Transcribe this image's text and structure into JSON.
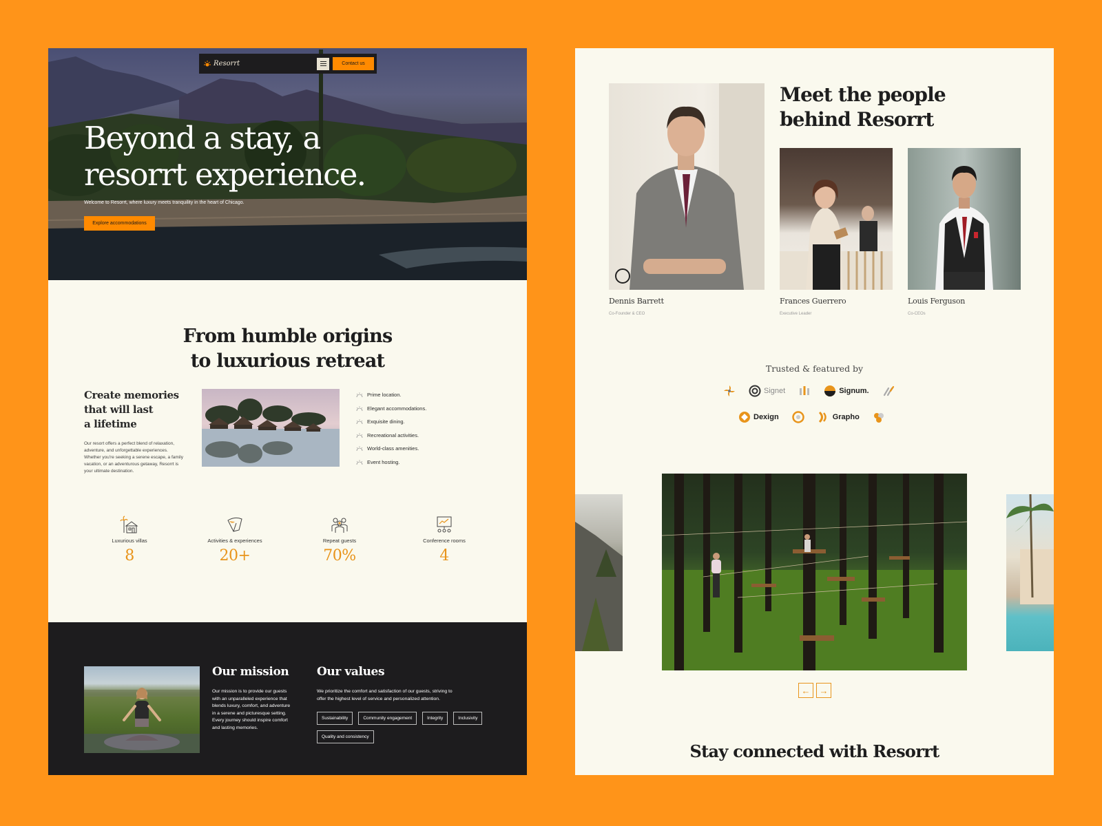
{
  "colors": {
    "background": "#FF9419",
    "accent": "#FF8A00",
    "value_accent": "#E8941B",
    "dark": "#1D1C1E",
    "cream": "#FAF9EE"
  },
  "nav": {
    "brand": "Resorrt",
    "contact_label": "Contact us",
    "menu_icon": "hamburger-menu-icon"
  },
  "hero": {
    "title_line1": "Beyond a stay, a",
    "title_line2": "resorrt experience.",
    "subtitle": "Welcome to Resorrt, where luxury meets tranquility in the heart of Chicago.",
    "cta_label": "Explore accommodations"
  },
  "origins": {
    "title_line1": "From humble origins",
    "title_line2": "to luxurious retreat",
    "memories_line1": "Create memories",
    "memories_line2": "that will last",
    "memories_line3": "a lifetime",
    "body": "Our resort offers a perfect blend of relaxation, adventure, and unforgettable experiences. Whether you're seeking a serene escape, a family vacation, or an adventurous getaway, Resorrt is your ultimate destination.",
    "features": [
      "Prime location.",
      "Elegant accommodations.",
      "Exquisite dining.",
      "Recreational activities.",
      "World-class amenities.",
      "Event hosting."
    ]
  },
  "stats": [
    {
      "label": "Luxurious villas",
      "value": "8",
      "icon": "villa-icon"
    },
    {
      "label": "Activities & experiences",
      "value": "20+",
      "icon": "hang-glider-icon"
    },
    {
      "label": "Repeat guests",
      "value": "70%",
      "icon": "guests-icon"
    },
    {
      "label": "Conference rooms",
      "value": "4",
      "icon": "presentation-board-icon"
    }
  ],
  "mission": {
    "title": "Our mission",
    "body": "Our mission is to provide our guests with an unparalleled experience that blends luxury, comfort, and adventure in a serene and picturesque setting. Every journey should inspire comfort and lasting memories.",
    "values_title": "Our values",
    "values_body": "We prioritize the comfort and satisfaction of our guests, striving to offer the highest level of service and personalized attention.",
    "tags": [
      "Sustainability",
      "Community engagement",
      "Integrity",
      "Inclusivity",
      "Quality and consistency"
    ]
  },
  "team": {
    "title_line1": "Meet the people",
    "title_line2": "behind Resorrt",
    "members": [
      {
        "name": "Dennis Barrett",
        "role": "Co-Founder & CEO"
      },
      {
        "name": "Frances Guerrero",
        "role": "Executive Leader"
      },
      {
        "name": "Louis Ferguson",
        "role": "Co-CEOs"
      }
    ]
  },
  "trusted": {
    "title": "Trusted & featured by",
    "brands": [
      "Signet",
      "Signum.",
      "Dexign",
      "Grapho"
    ]
  },
  "gallery": {
    "prev_icon": "arrow-left-icon",
    "next_icon": "arrow-right-icon"
  },
  "connected": {
    "title": "Stay connected with Resorrt"
  }
}
